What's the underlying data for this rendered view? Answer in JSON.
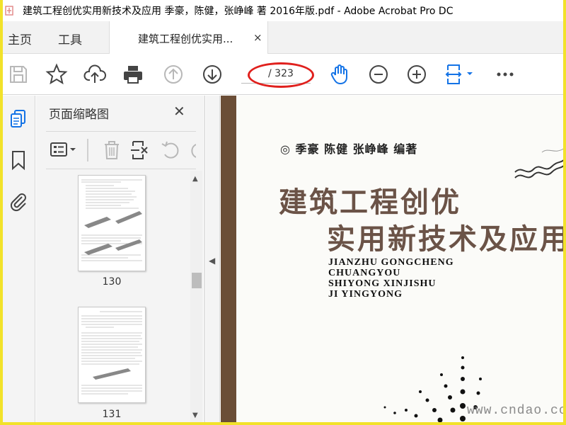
{
  "window": {
    "title": "建筑工程创优实用新技术及应用 季豪，陈健，张峥峰 著 2016年版.pdf - Adobe Acrobat Pro DC"
  },
  "tabs": {
    "home": "主页",
    "tools": "工具",
    "document": "建筑工程创优实用...",
    "close": "×"
  },
  "toolbar": {
    "page_current": "",
    "page_total": "/ 323",
    "icons": [
      "save-icon",
      "bookmark-star-icon",
      "cloud-upload-icon",
      "print-icon",
      "previous-page-icon",
      "next-page-icon",
      "hand-tool-icon",
      "zoom-out-icon",
      "zoom-in-icon",
      "fit-page-icon",
      "more-icon"
    ]
  },
  "rail": {
    "icons": [
      "page-thumbnails-icon",
      "bookmarks-icon",
      "attachments-icon"
    ]
  },
  "panel": {
    "title": "页面缩略图",
    "close": "✕",
    "thumbnails": [
      {
        "label": "130"
      },
      {
        "label": "131"
      }
    ]
  },
  "document": {
    "authors": "◎ 季豪 陈健 张峥峰 编著",
    "title_line1": "建筑工程创优",
    "title_line2": "实用新技术及应用",
    "pinyin": [
      "JIANZHU GONGCHENG",
      "CHUANGYOU",
      "SHIYONG XINJISHU",
      "JI YINGYONG"
    ]
  },
  "watermark": "www.cndao.com",
  "colors": {
    "accent_blue": "#1473e6",
    "annotation_red": "#e0201d",
    "title_brown": "#6b5347",
    "frame_yellow": "#f2e22a"
  }
}
